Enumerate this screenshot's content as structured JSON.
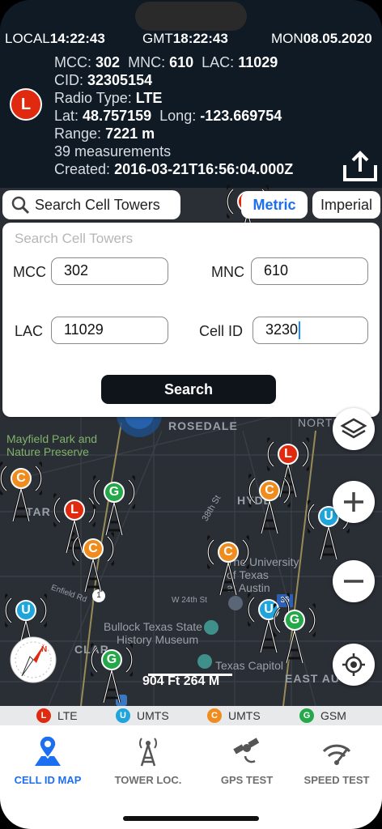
{
  "status": {
    "local_label": "LOCAL",
    "local_time": "14:22:43",
    "gmt_label": "GMT",
    "gmt_time": "18:22:43",
    "day": "MON",
    "date": "08.05.2020"
  },
  "cell_info": {
    "badge": "L",
    "mcc_label": "MCC:",
    "mcc": "302",
    "mnc_label": "MNC:",
    "mnc": "610",
    "lac_label": "LAC:",
    "lac": "11029",
    "cid_label": "CID:",
    "cid": "32305154",
    "radio_label": "Radio Type:",
    "radio": "LTE",
    "lat_label": "Lat:",
    "lat": "48.757159",
    "long_label": "Long:",
    "long": "-123.669754",
    "range_label": "Range:",
    "range": "7221 m",
    "measurements": "39 measurements",
    "created_label": "Created:",
    "created": "2016-03-21T16:56:04.000Z"
  },
  "toolbar": {
    "search_pill": "Search Cell Towers",
    "metric": "Metric",
    "imperial": "Imperial"
  },
  "search_panel": {
    "title": "Search Cell Towers",
    "mcc_label": "MCC",
    "mcc_value": "302",
    "mnc_label": "MNC",
    "mnc_value": "610",
    "lac_label": "LAC",
    "lac_value": "11029",
    "cellid_label": "Cell ID",
    "cellid_value": "3230",
    "button": "Search"
  },
  "map": {
    "labels": {
      "mayfield": "Mayfield Park and",
      "mayfield2": "Nature Preserve",
      "rosedale": "ROSEDALE",
      "north_lo": "NORTH LO",
      "hyde": "HYDE",
      "tar": "TAR",
      "univ1": "The University",
      "univ2": "of Texas",
      "univ3": "at Austin",
      "bullock1": "Bullock Texas State",
      "bullock2": "History Museum",
      "capitol": "Texas Capitol",
      "east": "EAST AU",
      "clark": "CLAR",
      "st38": "38th St",
      "st24": "W 24th St",
      "enfield": "Enfield Rd",
      "hwy1": "1",
      "hwy35": "35"
    },
    "towers": [
      "L",
      "G",
      "C",
      "L",
      "C",
      "U",
      "C",
      "C",
      "U",
      "U",
      "G",
      "G",
      "L"
    ],
    "scale": "904 Ft 264 M",
    "compass_n": "N"
  },
  "legend": [
    {
      "badge": "L",
      "label": "LTE",
      "color": "#e02a10"
    },
    {
      "badge": "U",
      "label": "UMTS",
      "color": "#1fa4dc"
    },
    {
      "badge": "C",
      "label": "UMTS",
      "color": "#f08c1e"
    },
    {
      "badge": "G",
      "label": "GSM",
      "color": "#25a84a"
    }
  ],
  "nav": {
    "cell_id_map": "CELL ID MAP",
    "tower_loc": "TOWER LOC.",
    "gps_test": "GPS TEST",
    "speed_test": "SPEED TEST"
  },
  "icons": [
    "search-icon",
    "share-icon",
    "layers-icon",
    "plus-icon",
    "minus-icon",
    "locate-icon",
    "compass-icon",
    "map-pin-icon",
    "tower-icon",
    "satellite-icon",
    "speedometer-icon"
  ],
  "colors": {
    "accent": "#1d6ff2",
    "lte": "#e02a10",
    "umts_u": "#1fa4dc",
    "umts_c": "#f08c1e",
    "gsm": "#25a84a"
  }
}
